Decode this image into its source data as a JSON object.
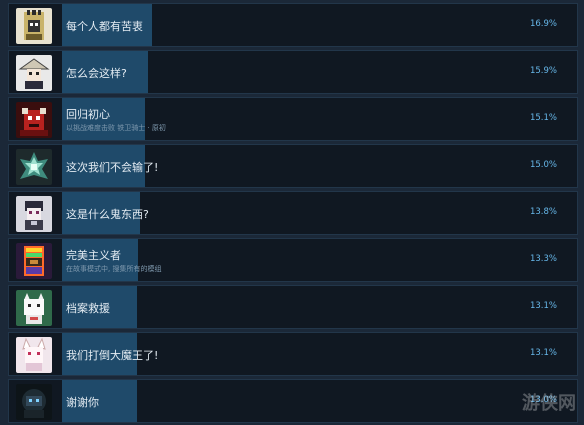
{
  "achievements": [
    {
      "title": "每个人都有苦衷",
      "desc": "",
      "percent": "16.9%",
      "ratio": 0.169,
      "icon": "castle-knight-icon"
    },
    {
      "title": "怎么会这样?",
      "desc": "",
      "percent": "15.9%",
      "ratio": 0.159,
      "icon": "straw-hat-ninja-icon"
    },
    {
      "title": "回归初心",
      "desc": "以挑战难度击败 铁卫骑士 · 原初",
      "percent": "15.1%",
      "ratio": 0.151,
      "icon": "red-demon-icon"
    },
    {
      "title": "这次我们不会输了!",
      "desc": "",
      "percent": "15.0%",
      "ratio": 0.15,
      "icon": "crystal-crown-icon"
    },
    {
      "title": "这是什么鬼东西?",
      "desc": "",
      "percent": "13.8%",
      "ratio": 0.138,
      "icon": "robot-girl-icon"
    },
    {
      "title": "完美主义者",
      "desc": "在故事模式中, 搜集所有的模组",
      "percent": "13.3%",
      "ratio": 0.133,
      "icon": "rainbow-cabinet-icon"
    },
    {
      "title": "档案救援",
      "desc": "",
      "percent": "13.1%",
      "ratio": 0.131,
      "icon": "cat-girl-icon"
    },
    {
      "title": "我们打倒大魔王了!",
      "desc": "",
      "percent": "13.1%",
      "ratio": 0.131,
      "icon": "fox-girl-icon"
    },
    {
      "title": "谢谢你",
      "desc": "",
      "percent": "13.0%",
      "ratio": 0.13,
      "icon": "dark-guardian-icon"
    }
  ],
  "watermark": "游侠网"
}
